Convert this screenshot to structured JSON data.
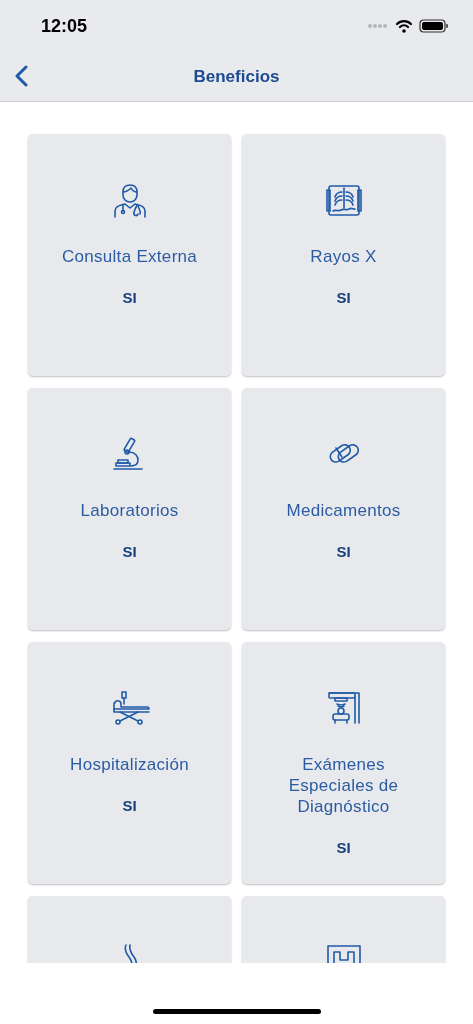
{
  "status_bar": {
    "time": "12:05"
  },
  "nav_bar": {
    "title": "Beneficios"
  },
  "cards": [
    {
      "kind": "full",
      "label": "Consulta Externa",
      "value": "SI"
    },
    {
      "kind": "full",
      "label": "Rayos X",
      "value": "SI"
    },
    {
      "kind": "full",
      "label": "Laboratorios",
      "value": "SI"
    },
    {
      "kind": "full",
      "label": "Medicamentos",
      "value": "SI"
    },
    {
      "kind": "full",
      "label": "Hospitalización",
      "value": "SI"
    },
    {
      "kind": "full",
      "label": "Exámenes Especiales de Diagnóstico",
      "value": "SI"
    },
    {
      "kind": "partial"
    },
    {
      "kind": "partial"
    }
  ]
}
